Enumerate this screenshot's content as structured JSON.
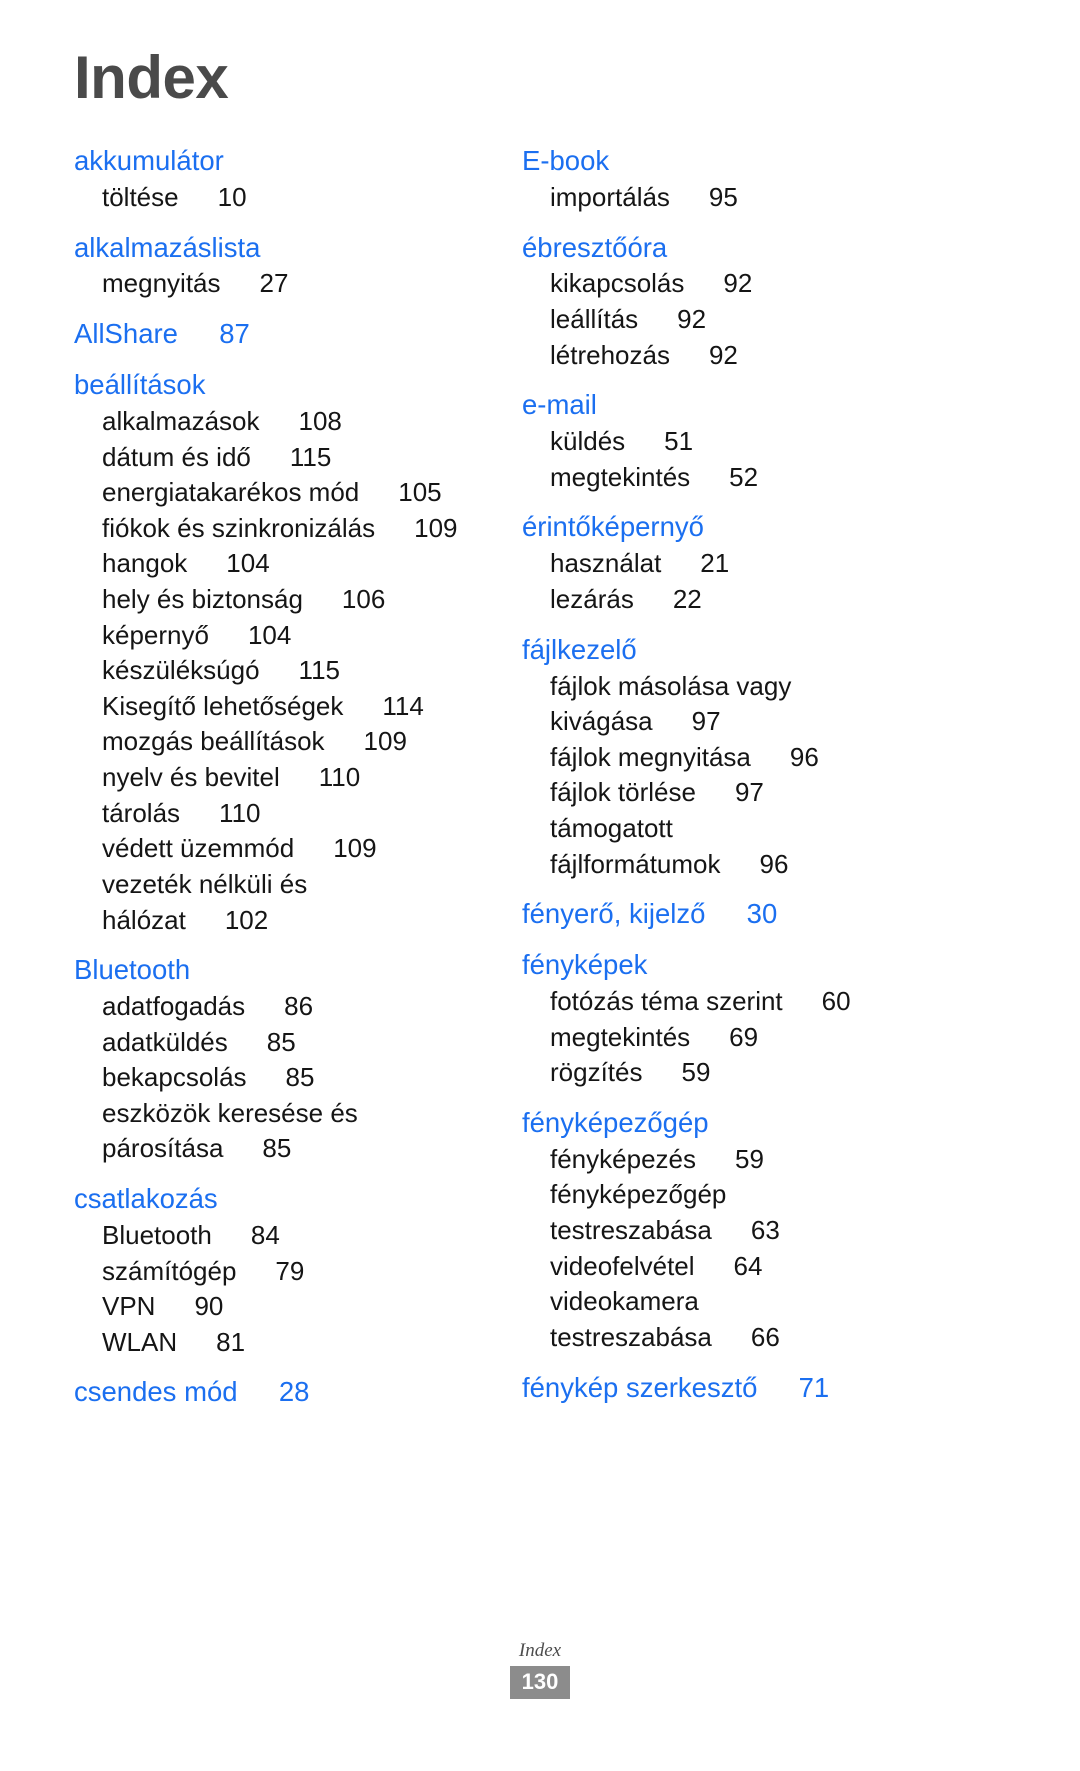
{
  "document": {
    "title": "Index",
    "footer": {
      "label": "Index",
      "page_number": "130"
    },
    "colors": {
      "heading": "#1b6ff0",
      "body": "#151515",
      "title": "#4a4a4a",
      "page_box": "#8c8c8c"
    }
  },
  "columns": [
    {
      "id": "left",
      "groups": [
        {
          "heading": "akkumulátor",
          "heading_page": "",
          "entries": [
            {
              "text": "töltése",
              "page": "10"
            }
          ]
        },
        {
          "heading": "alkalmazáslista",
          "heading_page": "",
          "entries": [
            {
              "text": "megnyitás",
              "page": "27"
            }
          ]
        },
        {
          "heading": "AllShare",
          "heading_page": "87",
          "entries": []
        },
        {
          "heading": "beállítások",
          "heading_page": "",
          "entries": [
            {
              "text": "alkalmazások",
              "page": "108"
            },
            {
              "text": "dátum és idő",
              "page": "115"
            },
            {
              "text": "energiatakarékos mód",
              "page": "105"
            },
            {
              "text": "fiókok és szinkronizálás",
              "page": "109"
            },
            {
              "text": "hangok",
              "page": "104"
            },
            {
              "text": "hely és biztonság",
              "page": "106"
            },
            {
              "text": "képernyő",
              "page": "104"
            },
            {
              "text": "készüléksúgó",
              "page": "115"
            },
            {
              "text": "Kisegítő lehetőségek",
              "page": "114"
            },
            {
              "text": "mozgás beállítások",
              "page": "109"
            },
            {
              "text": "nyelv és bevitel",
              "page": "110"
            },
            {
              "text": "tárolás",
              "page": "110"
            },
            {
              "text": "védett üzemmód",
              "page": "109"
            },
            {
              "text": "vezeték nélküli és",
              "page": "",
              "continuation": "hálózat",
              "continuation_page": "102"
            }
          ]
        },
        {
          "heading": "Bluetooth",
          "heading_page": "",
          "entries": [
            {
              "text": "adatfogadás",
              "page": "86"
            },
            {
              "text": "adatküldés",
              "page": "85"
            },
            {
              "text": "bekapcsolás",
              "page": "85"
            },
            {
              "text": "eszközök keresése és",
              "page": "",
              "continuation": "párosítása",
              "continuation_page": "85"
            }
          ]
        },
        {
          "heading": "csatlakozás",
          "heading_page": "",
          "entries": [
            {
              "text": "Bluetooth",
              "page": "84"
            },
            {
              "text": "számítógép",
              "page": "79"
            },
            {
              "text": "VPN",
              "page": "90"
            },
            {
              "text": "WLAN",
              "page": "81"
            }
          ]
        },
        {
          "heading": "csendes mód",
          "heading_page": "28",
          "entries": []
        }
      ]
    },
    {
      "id": "right",
      "groups": [
        {
          "heading": "E-book",
          "heading_page": "",
          "entries": [
            {
              "text": "importálás",
              "page": "95"
            }
          ]
        },
        {
          "heading": "ébresztőóra",
          "heading_page": "",
          "entries": [
            {
              "text": "kikapcsolás",
              "page": "92"
            },
            {
              "text": "leállítás",
              "page": "92"
            },
            {
              "text": "létrehozás",
              "page": "92"
            }
          ]
        },
        {
          "heading": "e-mail",
          "heading_page": "",
          "entries": [
            {
              "text": "küldés",
              "page": "51"
            },
            {
              "text": "megtekintés",
              "page": "52"
            }
          ]
        },
        {
          "heading": "érintőképernyő",
          "heading_page": "",
          "entries": [
            {
              "text": "használat",
              "page": "21"
            },
            {
              "text": "lezárás",
              "page": "22"
            }
          ]
        },
        {
          "heading": "fájlkezelő",
          "heading_page": "",
          "entries": [
            {
              "text": "fájlok másolása vagy",
              "page": "",
              "continuation": "kivágása",
              "continuation_page": "97"
            },
            {
              "text": "fájlok megnyitása",
              "page": "96"
            },
            {
              "text": "fájlok törlése",
              "page": "97"
            },
            {
              "text": "támogatott",
              "page": "",
              "continuation": "fájlformátumok",
              "continuation_page": "96"
            }
          ]
        },
        {
          "heading": "fényerő, kijelző",
          "heading_page": "30",
          "entries": []
        },
        {
          "heading": "fényképek",
          "heading_page": "",
          "entries": [
            {
              "text": "fotózás téma szerint",
              "page": "60"
            },
            {
              "text": "megtekintés",
              "page": "69"
            },
            {
              "text": "rögzítés",
              "page": "59"
            }
          ]
        },
        {
          "heading": "fényképezőgép",
          "heading_page": "",
          "entries": [
            {
              "text": "fényképezés",
              "page": "59"
            },
            {
              "text": "fényképezőgép",
              "page": "",
              "continuation": "testreszabása",
              "continuation_page": "63"
            },
            {
              "text": "videofelvétel",
              "page": "64"
            },
            {
              "text": "videokamera",
              "page": "",
              "continuation": "testreszabása",
              "continuation_page": "66"
            }
          ]
        },
        {
          "heading": "fénykép szerkesztő",
          "heading_page": "71",
          "entries": []
        }
      ]
    }
  ]
}
